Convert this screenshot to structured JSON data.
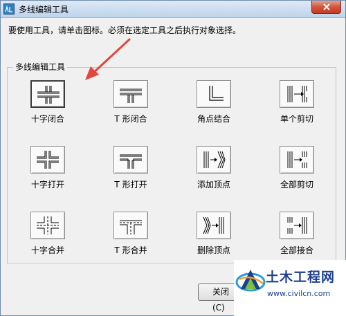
{
  "window": {
    "title": "多线编辑工具"
  },
  "instruction": "要使用工具，请单击图标。必须在选定工具之后执行对象选择。",
  "group": {
    "label": "多线编辑工具",
    "tools": [
      {
        "label": "十字闭合",
        "icon": "cross-closed-icon",
        "selected": true
      },
      {
        "label": "T 形闭合",
        "icon": "tee-closed-icon",
        "selected": false
      },
      {
        "label": "角点结合",
        "icon": "corner-joint-icon",
        "selected": false
      },
      {
        "label": "单个剪切",
        "icon": "cut-single-icon",
        "selected": false
      },
      {
        "label": "十字打开",
        "icon": "cross-open-icon",
        "selected": false
      },
      {
        "label": "T 形打开",
        "icon": "tee-open-icon",
        "selected": false
      },
      {
        "label": "添加顶点",
        "icon": "add-vertex-icon",
        "selected": false
      },
      {
        "label": "全部剪切",
        "icon": "cut-all-icon",
        "selected": false
      },
      {
        "label": "十字合并",
        "icon": "cross-merged-icon",
        "selected": false
      },
      {
        "label": "T 形合并",
        "icon": "tee-merged-icon",
        "selected": false
      },
      {
        "label": "删除顶点",
        "icon": "delete-vertex-icon",
        "selected": false
      },
      {
        "label": "全部接合",
        "icon": "weld-all-icon",
        "selected": false
      }
    ]
  },
  "buttons": {
    "close": "关闭(C)"
  },
  "watermark": {
    "name": "土木工程网",
    "url": "www.civilcn.com"
  },
  "colors": {
    "annotation_arrow": "#e3463a",
    "watermark_blue": "#1d3f8f"
  }
}
